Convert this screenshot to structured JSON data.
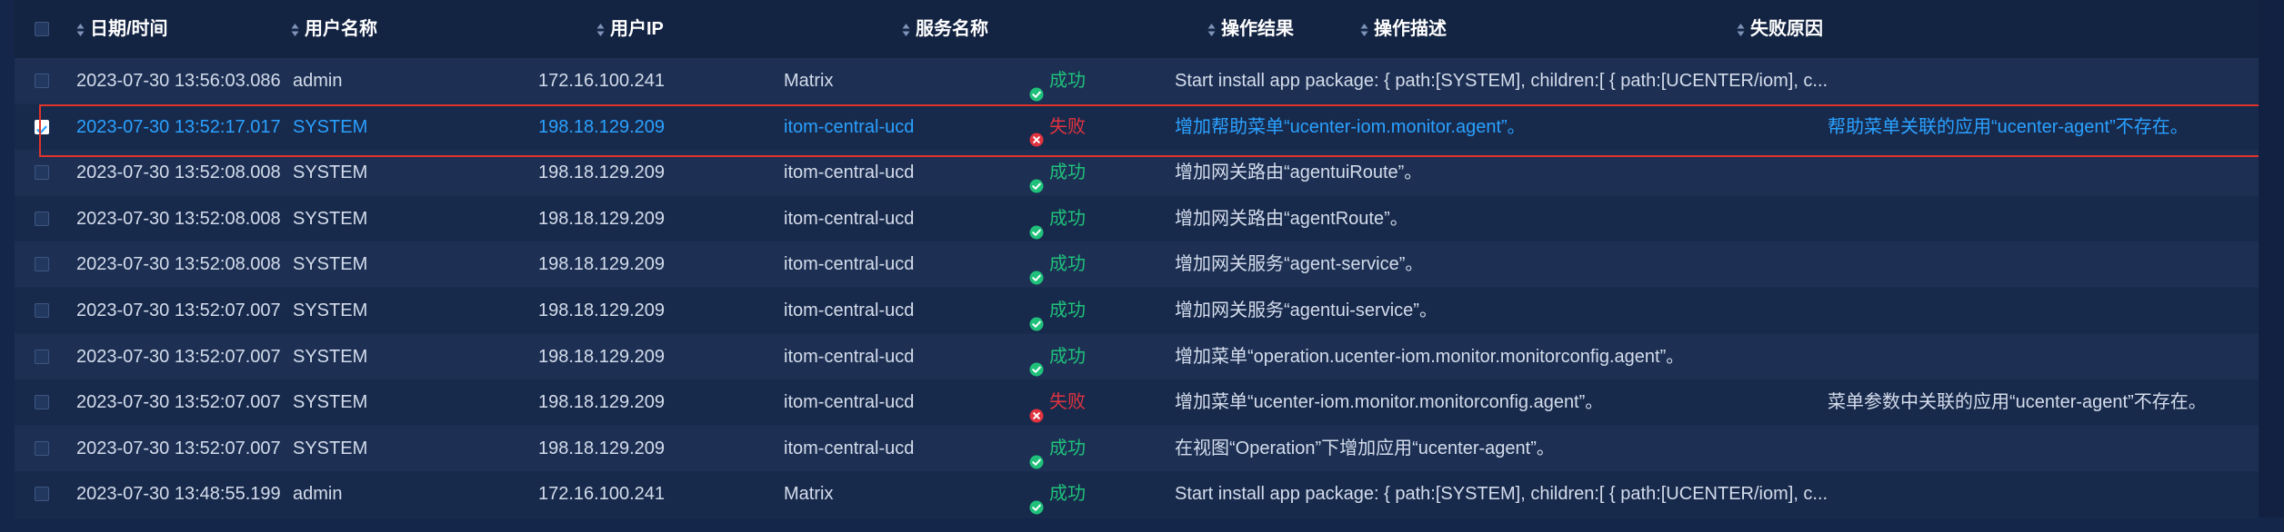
{
  "columns": {
    "datetime": "日期/时间",
    "username": "用户名称",
    "user_ip": "用户IP",
    "service": "服务名称",
    "result": "操作结果",
    "description": "操作描述",
    "failure_reason": "失败原因"
  },
  "status_labels": {
    "success": "成功",
    "fail": "失败"
  },
  "colors": {
    "success": "#1fc07a",
    "fail": "#e0333f",
    "selected_text": "#2aa1ff",
    "highlight_border": "#e0342a"
  },
  "rows": [
    {
      "datetime": "2023-07-30 13:56:03.086",
      "user": "admin",
      "ip": "172.16.100.241",
      "service": "Matrix",
      "result": "成功",
      "status": "success",
      "description": "Start install app package: { path:[SYSTEM], children:[ { path:[UCENTER/iom], c...",
      "reason": "",
      "selected": false
    },
    {
      "datetime": "2023-07-30 13:52:17.017",
      "user": "SYSTEM",
      "ip": "198.18.129.209",
      "service": "itom-central-ucd",
      "result": "失败",
      "status": "fail",
      "description": "增加帮助菜单“ucenter-iom.monitor.agent”。",
      "reason": "帮助菜单关联的应用“ucenter-agent”不存在。",
      "selected": true
    },
    {
      "datetime": "2023-07-30 13:52:08.008",
      "user": "SYSTEM",
      "ip": "198.18.129.209",
      "service": "itom-central-ucd",
      "result": "成功",
      "status": "success",
      "description": "增加网关路由“agentuiRoute”。",
      "reason": "",
      "selected": false
    },
    {
      "datetime": "2023-07-30 13:52:08.008",
      "user": "SYSTEM",
      "ip": "198.18.129.209",
      "service": "itom-central-ucd",
      "result": "成功",
      "status": "success",
      "description": "增加网关路由“agentRoute”。",
      "reason": "",
      "selected": false
    },
    {
      "datetime": "2023-07-30 13:52:08.008",
      "user": "SYSTEM",
      "ip": "198.18.129.209",
      "service": "itom-central-ucd",
      "result": "成功",
      "status": "success",
      "description": "增加网关服务“agent-service”。",
      "reason": "",
      "selected": false
    },
    {
      "datetime": "2023-07-30 13:52:07.007",
      "user": "SYSTEM",
      "ip": "198.18.129.209",
      "service": "itom-central-ucd",
      "result": "成功",
      "status": "success",
      "description": "增加网关服务“agentui-service”。",
      "reason": "",
      "selected": false
    },
    {
      "datetime": "2023-07-30 13:52:07.007",
      "user": "SYSTEM",
      "ip": "198.18.129.209",
      "service": "itom-central-ucd",
      "result": "成功",
      "status": "success",
      "description": "增加菜单“operation.ucenter-iom.monitor.monitorconfig.agent”。",
      "reason": "",
      "selected": false
    },
    {
      "datetime": "2023-07-30 13:52:07.007",
      "user": "SYSTEM",
      "ip": "198.18.129.209",
      "service": "itom-central-ucd",
      "result": "失败",
      "status": "fail",
      "description": "增加菜单“ucenter-iom.monitor.monitorconfig.agent”。",
      "reason": "菜单参数中关联的应用“ucenter-agent”不存在。",
      "selected": false
    },
    {
      "datetime": "2023-07-30 13:52:07.007",
      "user": "SYSTEM",
      "ip": "198.18.129.209",
      "service": "itom-central-ucd",
      "result": "成功",
      "status": "success",
      "description": "在视图“Operation”下增加应用“ucenter-agent”。",
      "reason": "",
      "selected": false
    },
    {
      "datetime": "2023-07-30 13:48:55.199",
      "user": "admin",
      "ip": "172.16.100.241",
      "service": "Matrix",
      "result": "成功",
      "status": "success",
      "description": "Start install app package: { path:[SYSTEM], children:[ { path:[UCENTER/iom], c...",
      "reason": "",
      "selected": false
    }
  ]
}
